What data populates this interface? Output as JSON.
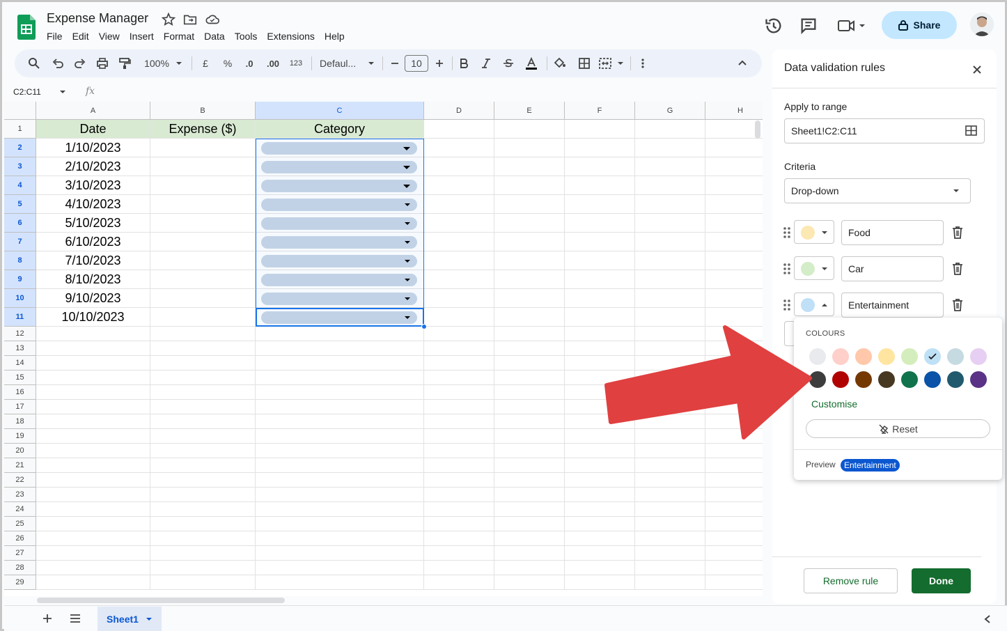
{
  "app": {
    "title": "Expense Manager",
    "menu": [
      "File",
      "Edit",
      "View",
      "Insert",
      "Format",
      "Data",
      "Tools",
      "Extensions",
      "Help"
    ],
    "share_label": "Share"
  },
  "toolbar": {
    "zoom": "100%",
    "currency": "£",
    "percent": "%",
    "dec_dec": ".0",
    "dec_inc": ".00",
    "number_format": "123",
    "font": "Defaul...",
    "font_size": "10"
  },
  "formula_bar": {
    "range": "C2:C11",
    "fx": "fx"
  },
  "grid": {
    "columns": [
      "A",
      "B",
      "C",
      "D",
      "E",
      "F",
      "G",
      "H"
    ],
    "rows": [
      "1",
      "2",
      "3",
      "4",
      "5",
      "6",
      "7",
      "8",
      "9",
      "10",
      "11",
      "12",
      "13",
      "14",
      "15",
      "16",
      "17",
      "18",
      "19",
      "20",
      "21",
      "22",
      "23",
      "24",
      "25",
      "26",
      "27",
      "28",
      "29"
    ],
    "headers": [
      "Date",
      "Expense ($)",
      "Category"
    ],
    "dates": [
      "1/10/2023",
      "2/10/2023",
      "3/10/2023",
      "4/10/2023",
      "5/10/2023",
      "6/10/2023",
      "7/10/2023",
      "8/10/2023",
      "9/10/2023",
      "10/10/2023"
    ]
  },
  "sheet_tab": "Sheet1",
  "panel": {
    "title": "Data validation rules",
    "apply_label": "Apply to range",
    "range_value": "Sheet1!C2:C11",
    "criteria_label": "Criteria",
    "criteria_value": "Drop-down",
    "items": [
      {
        "label": "Food",
        "color": "#fce8b2"
      },
      {
        "label": "Car",
        "color": "#d4edc9"
      },
      {
        "label": "Entertainment",
        "color": "#bfe0f6"
      }
    ],
    "remove_label": "Remove rule",
    "done_label": "Done"
  },
  "color_popup": {
    "title": "COLOURS",
    "light_colors": [
      "#e8eaed",
      "#ffcfc9",
      "#ffc8aa",
      "#ffe5a0",
      "#d4edbc",
      "#bfe1f6",
      "#c6dbe1",
      "#e6cff2"
    ],
    "dark_colors": [
      "#3d3d3d",
      "#b10202",
      "#753800",
      "#473822",
      "#11734b",
      "#0a53a8",
      "#215a6c",
      "#5a3286"
    ],
    "selected_index": 5,
    "customise_label": "Customise",
    "reset_label": "Reset",
    "preview_label": "Preview",
    "preview_chip": "Entertainment",
    "preview_color": "#0b57d0"
  },
  "annotation": {
    "arrow_color": "#e04040"
  }
}
